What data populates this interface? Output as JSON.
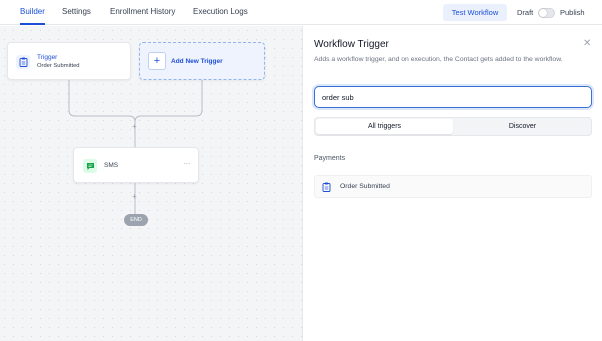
{
  "nav": {
    "tabs": [
      {
        "label": "Builder",
        "active": true
      },
      {
        "label": "Settings",
        "active": false
      },
      {
        "label": "Enrollment History",
        "active": false
      },
      {
        "label": "Execution Logs",
        "active": false
      }
    ],
    "test_workflow": "Test Workflow",
    "draft": "Draft",
    "publish": "Publish"
  },
  "canvas": {
    "trigger_card": {
      "title": "Trigger",
      "subtitle": "Order Submitted"
    },
    "add_trigger": {
      "plus": "+",
      "label": "Add New Trigger"
    },
    "plus_symbol": "+",
    "sms_card": {
      "label": "SMS",
      "more": "···"
    },
    "end": "END"
  },
  "panel": {
    "title": "Workflow Trigger",
    "close": "✕",
    "description": "Adds a workflow trigger, and on execution, the Contact gets added to the workflow.",
    "search": {
      "value": "order sub",
      "placeholder": ""
    },
    "segments": [
      "All triggers",
      "Discover"
    ],
    "section": "Payments",
    "options": [
      {
        "label": "Order Submitted",
        "icon": "clipboard-icon"
      }
    ]
  },
  "colors": {
    "accent": "#1d4ed8",
    "sms_green": "#16a34a",
    "canvas_bg": "#f4f5f7"
  }
}
